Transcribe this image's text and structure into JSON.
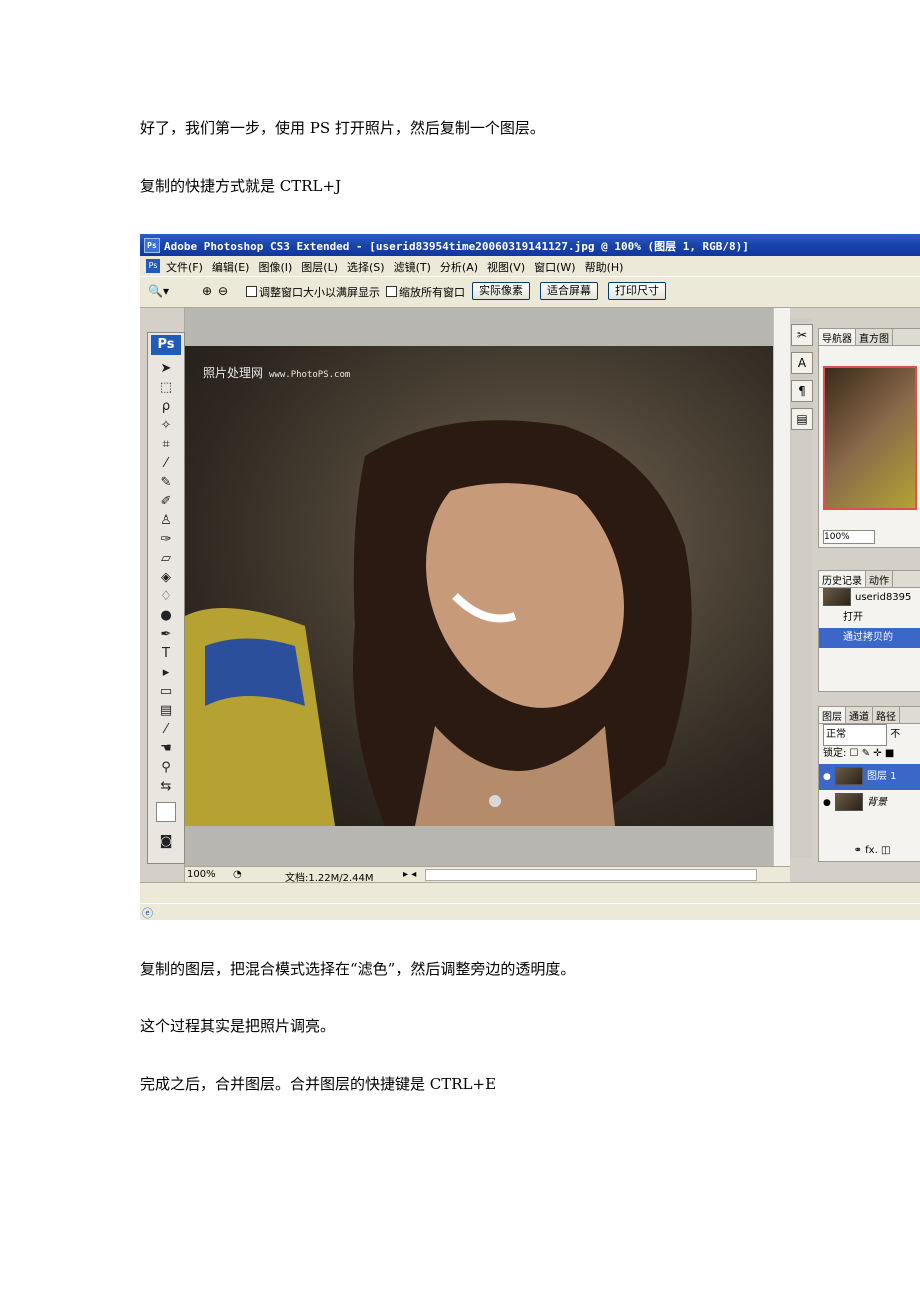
{
  "paragraphs": {
    "p1": "好了，我们第一步，使用 PS 打开照片，然后复制一个图层。",
    "p2": "复制的快捷方式就是  CTRL+J",
    "p3": "复制的图层，把混合模式选择在“滤色”，然后调整旁边的透明度。",
    "p4": "这个过程其实是把照片调亮。",
    "p5": "完成之后，合并图层。合并图层的快捷键是  CTRL+E"
  },
  "screenshot": {
    "title_badge": "Ps",
    "title": "Adobe Photoshop CS3 Extended - [userid83954time20060319141127.jpg @ 100% (图层 1, RGB/8)]",
    "menu": [
      "文件(F)",
      "编辑(E)",
      "图像(I)",
      "图层(L)",
      "选择(S)",
      "滤镜(T)",
      "分析(A)",
      "视图(V)",
      "窗口(W)",
      "帮助(H)"
    ],
    "options": {
      "resize_windows": "调整窗口大小以满屏显示",
      "zoom_all": "缩放所有窗口",
      "btn_actual": "实际像素",
      "btn_fit": "适合屏幕",
      "btn_print": "打印尺寸"
    },
    "toolbox_logo": "Ps",
    "watermark": "照片处理网",
    "watermark_url": "www.PhotoPS.com",
    "doc_status": {
      "zoom": "100%",
      "doc_info": "文档:1.22M/2.44M"
    },
    "navigator": {
      "tabs": [
        "导航器",
        "直方图"
      ],
      "zoom": "100%"
    },
    "history": {
      "tabs": [
        "历史记录",
        "动作"
      ],
      "snapshot": "userid8395",
      "items": [
        "打开",
        "通过拷贝的"
      ]
    },
    "layers": {
      "tabs": [
        "图层",
        "通道",
        "路径"
      ],
      "blend_mode": "正常",
      "opacity_label": "不",
      "lock_label": "锁定:",
      "items": [
        "图层 1",
        "背景"
      ]
    }
  }
}
